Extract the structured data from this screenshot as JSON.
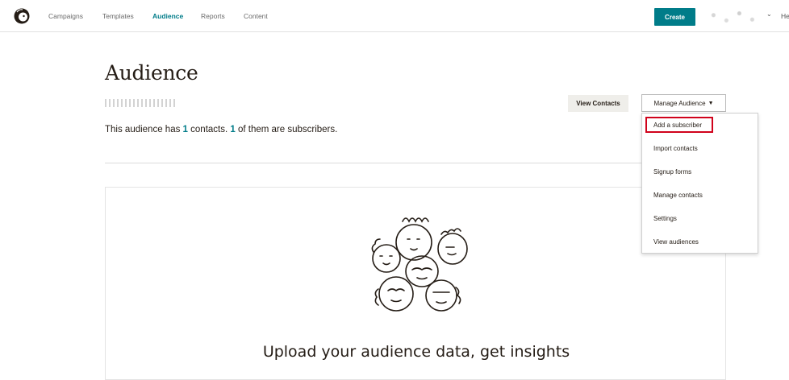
{
  "nav": {
    "items": [
      {
        "label": "Campaigns"
      },
      {
        "label": "Templates"
      },
      {
        "label": "Audience"
      },
      {
        "label": "Reports"
      },
      {
        "label": "Content"
      }
    ],
    "create_label": "Create",
    "account_partial": "He",
    "accent_color": "#007c89"
  },
  "header": {
    "title": "Audience",
    "summary_prefix": "This audience has ",
    "contacts_count": "1",
    "summary_middle": " contacts. ",
    "subscribers_count": "1",
    "summary_suffix": " of them are subscribers.",
    "view_contacts_label": "View Contacts",
    "manage_audience_label": "Manage Audience"
  },
  "dropdown": {
    "items": [
      {
        "label": "Add a subscriber"
      },
      {
        "label": "Import contacts"
      },
      {
        "label": "Signup forms"
      },
      {
        "label": "Manage contacts"
      },
      {
        "label": "Settings"
      },
      {
        "label": "View audiences"
      }
    ],
    "highlight_color": "#d0021b"
  },
  "card": {
    "heading": "Upload your audience data, get insights"
  }
}
